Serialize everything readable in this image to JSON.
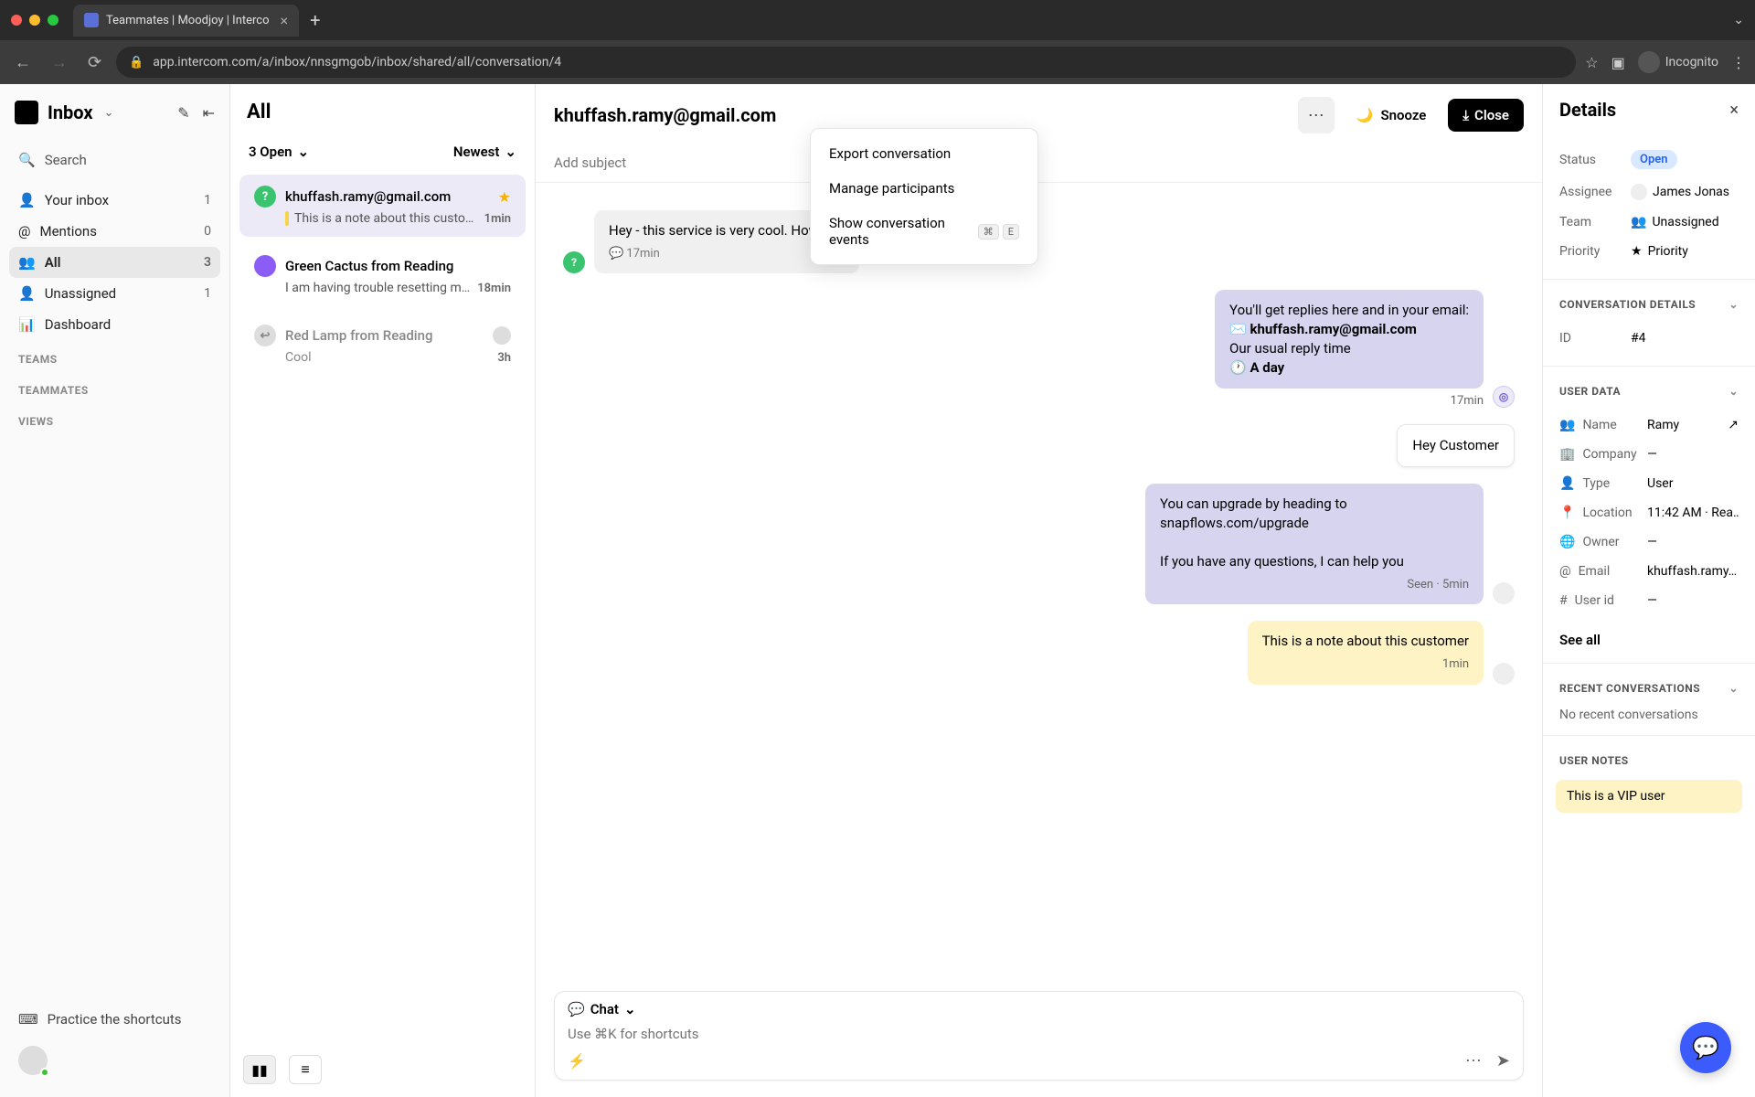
{
  "browser": {
    "tab_title": "Teammates | Moodjoy | Interco",
    "url": "app.intercom.com/a/inbox/nnsgmgob/inbox/shared/all/conversation/4",
    "incognito_label": "Incognito"
  },
  "sidebar": {
    "inbox_label": "Inbox",
    "search_label": "Search",
    "items": [
      {
        "icon": "👤",
        "label": "Your inbox",
        "count": "1"
      },
      {
        "icon": "@",
        "label": "Mentions",
        "count": "0"
      },
      {
        "icon": "👥",
        "label": "All",
        "count": "3",
        "active": true
      },
      {
        "icon": "👤",
        "label": "Unassigned",
        "count": "1"
      },
      {
        "icon": "📊",
        "label": "Dashboard",
        "count": ""
      }
    ],
    "sections": [
      "TEAMS",
      "TEAMMATES",
      "VIEWS"
    ],
    "practice_label": "Practice the shortcuts"
  },
  "list": {
    "title": "All",
    "open_filter": "3 Open",
    "sort_label": "Newest",
    "items": [
      {
        "avatar_char": "?",
        "avatar_color": "green",
        "name": "khuffash.ramy@gmail.com",
        "starred": true,
        "preview": "This is a note about this customer",
        "note": true,
        "time": "1min",
        "selected": true
      },
      {
        "avatar_char": "",
        "avatar_color": "purple",
        "name": "Green Cactus from Reading",
        "preview": "I am having trouble resetting my …",
        "time": "18min"
      },
      {
        "avatar_char": "↩",
        "avatar_color": "grey",
        "name": "Red Lamp from Reading",
        "preview": "Cool",
        "time": "3h"
      }
    ]
  },
  "conversation": {
    "email": "khuffash.ramy@gmail.com",
    "snooze_label": "Snooze",
    "close_label": "Close",
    "subject_placeholder": "Add subject",
    "dropdown": {
      "export": "Export conversation",
      "manage": "Manage participants",
      "events": "Show conversation events",
      "shortcut_mod": "⌘",
      "shortcut_key": "E"
    },
    "messages": {
      "incoming_text": "Hey - this service is very cool. How can",
      "incoming_time": "17min",
      "system_line1": "You'll get replies here and in your email:",
      "system_email": "khuffash.ramy@gmail.com",
      "system_line2": "Our usual reply time",
      "system_line3": "A day",
      "system_time": "17min",
      "agent_reply1": "Hey Customer",
      "agent_reply2_l1": "You can upgrade by heading to snapflows.com/upgrade",
      "agent_reply2_l2": "If you have any questions, I can help you",
      "agent_reply2_meta": "Seen · 5min",
      "note_text": "This is a note about this customer",
      "note_time": "1min"
    },
    "composer": {
      "mode_label": "Chat",
      "placeholder": "Use ⌘K for shortcuts"
    }
  },
  "details": {
    "title": "Details",
    "status_label": "Status",
    "status_value": "Open",
    "assignee_label": "Assignee",
    "assignee_value": "James Jonas",
    "team_label": "Team",
    "team_value": "Unassigned",
    "priority_label": "Priority",
    "priority_value": "Priority",
    "conv_details_heading": "CONVERSATION DETAILS",
    "id_label": "ID",
    "id_value": "#4",
    "user_data_heading": "USER DATA",
    "user_rows": [
      {
        "icon": "👥",
        "label": "Name",
        "value": "Ramy",
        "ext": true
      },
      {
        "icon": "🏢",
        "label": "Company",
        "value": "—"
      },
      {
        "icon": "👤",
        "label": "Type",
        "value": "User"
      },
      {
        "icon": "📍",
        "label": "Location",
        "value": "11:42 AM · Rea…"
      },
      {
        "icon": "🌐",
        "label": "Owner",
        "value": "—"
      },
      {
        "icon": "@",
        "label": "Email",
        "value": "khuffash.ramy…"
      },
      {
        "icon": "#",
        "label": "User id",
        "value": "—"
      }
    ],
    "see_all": "See all",
    "recent_heading": "RECENT CONVERSATIONS",
    "no_recent": "No recent conversations",
    "user_notes_heading": "USER NOTES",
    "user_note": "This is a VIP user"
  }
}
